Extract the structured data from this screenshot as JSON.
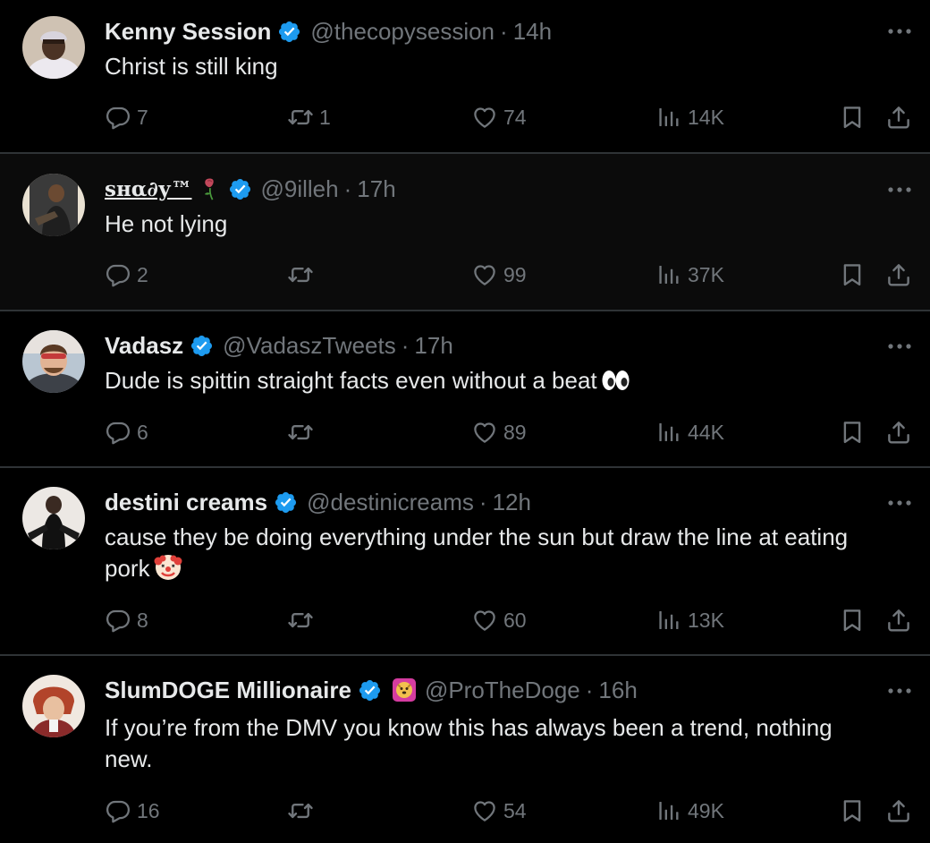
{
  "colors": {
    "background": "#000000",
    "text_primary": "#e7e9ea",
    "text_secondary": "#71767b",
    "divider": "#2f3336",
    "verified": "#1d9bf0"
  },
  "tweets": [
    {
      "name": "Kenny Session",
      "verified": true,
      "handle": "@thecopysession",
      "separator": "·",
      "time": "14h",
      "text": "Christ is still king",
      "reply_count": "7",
      "retweet_count": "1",
      "like_count": "74",
      "view_count": "14K"
    },
    {
      "name": "ѕнα∂у™",
      "name_emoji": "wilted-rose-icon",
      "verified": true,
      "handle": "@9illeh",
      "separator": "·",
      "time": "17h",
      "text": "He not lying",
      "reply_count": "2",
      "retweet_count": "",
      "like_count": "99",
      "view_count": "37K"
    },
    {
      "name": "Vadasz",
      "verified": true,
      "handle": "@VadaszTweets",
      "separator": "·",
      "time": "17h",
      "text": "Dude is spittin straight facts even without a beat",
      "text_emoji": "eyes-icon",
      "reply_count": "6",
      "retweet_count": "",
      "like_count": "89",
      "view_count": "44K"
    },
    {
      "name": "destini creams",
      "verified": true,
      "handle": "@destinicreams",
      "separator": "·",
      "time": "12h",
      "text_line1": "cause they be doing everything under the sun but draw the line at eating",
      "text_line2": "pork",
      "text_emoji": "clown-face-icon",
      "reply_count": "8",
      "retweet_count": "",
      "like_count": "60",
      "view_count": "13K"
    },
    {
      "name": "SlumDOGE Millionaire",
      "verified": true,
      "affiliate_badge": "doge-badge-icon",
      "handle": "@ProTheDoge",
      "separator": "·",
      "time": "16h",
      "text_line1": "If you’re from the DMV you know this has always been a trend, nothing",
      "text_line2": "new.",
      "reply_count": "16",
      "retweet_count": "",
      "like_count": "54",
      "view_count": "49K"
    }
  ]
}
